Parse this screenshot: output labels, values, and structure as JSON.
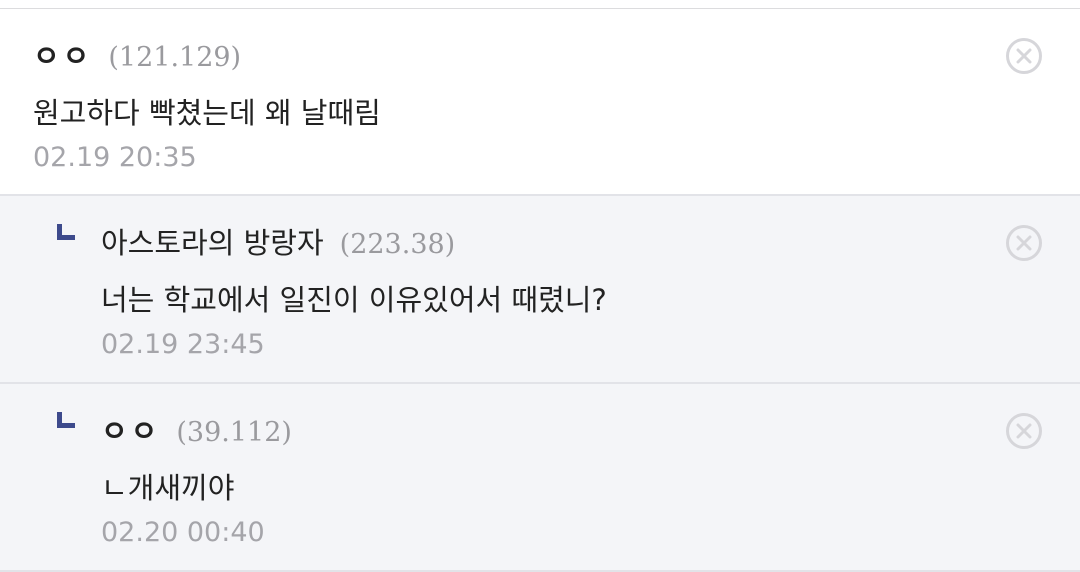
{
  "comments": [
    {
      "nickname": "ㅇㅇ",
      "ip": "(121.129)",
      "text": "원고하다 빡쳤는데 왜 날때림",
      "date": "02.19 20:35",
      "is_reply": false
    },
    {
      "nickname": "아스토라의 방랑자",
      "ip": "(223.38)",
      "text": "너는 학교에서 일진이 이유있어서 때렸니?",
      "date": "02.19 23:45",
      "is_reply": true
    },
    {
      "nickname": "ㅇㅇ",
      "ip": "(39.112)",
      "text": "ㄴ개새끼야",
      "date": "02.20 00:40",
      "is_reply": true
    }
  ],
  "icons": {
    "delete": "close-circle-icon",
    "reply": "reply-corner-icon"
  },
  "colors": {
    "reply_marker": "#3d4a8c",
    "reply_background": "#f4f5f8",
    "meta_text": "#a5a5aa"
  }
}
